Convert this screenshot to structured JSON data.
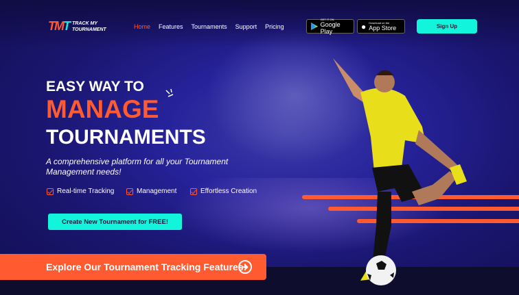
{
  "brand": {
    "mark": "TM",
    "mark2": "T",
    "line1": "TRACK MY",
    "line2": "TOURNAMENT"
  },
  "nav": {
    "items": [
      "Home",
      "Features",
      "Tournaments",
      "Support",
      "Pricing"
    ],
    "active": "Home"
  },
  "stores": {
    "google_small": "GET IT ON",
    "google": "Google Play",
    "apple_small": "Download on the",
    "apple": "App Store"
  },
  "signup": "Sign Up",
  "hero": {
    "line1": "EASY WAY TO",
    "line2": "MANAGE",
    "line3": "TOURNAMENTS",
    "subtitle": "A comprehensive platform for all your Tournament Management  needs!",
    "features": [
      "Real-time Tracking",
      "Management",
      "Effortless Creation"
    ],
    "cta": "Create New Tournament for FREE!"
  },
  "explore": "Explore Our Tournament Tracking Features!",
  "colors": {
    "accent": "#ff5a30",
    "cyan": "#12f5dc",
    "bg": "#1a1670"
  }
}
